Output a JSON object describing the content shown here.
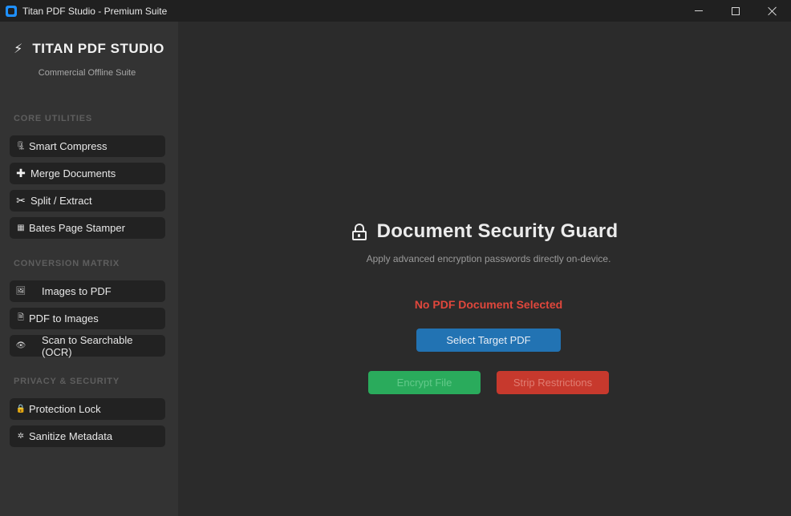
{
  "window": {
    "title": "Titan PDF Studio - Premium Suite",
    "icons": {
      "minimize": "minimize-icon",
      "maximize": "maximize-icon",
      "close": "close-icon"
    }
  },
  "sidebar": {
    "brand_icon": "⚡",
    "brand_title": "TITAN PDF STUDIO",
    "brand_subtitle": "Commercial Offline Suite",
    "sections": [
      {
        "label": "CORE UTILITIES",
        "items": [
          {
            "icon": "🗜",
            "label": "Smart Compress"
          },
          {
            "icon": "✚",
            "label": "Merge Documents"
          },
          {
            "icon": "✂",
            "label": "Split / Extract"
          },
          {
            "icon": "▦",
            "label": "Bates Page Stamper"
          }
        ]
      },
      {
        "label": "CONVERSION MATRIX",
        "items": [
          {
            "icon": "🖼",
            "label": "Images to PDF"
          },
          {
            "icon": "🗎",
            "label": "PDF to Images"
          },
          {
            "icon": "👁",
            "label": "Scan to Searchable (OCR)"
          }
        ]
      },
      {
        "label": "PRIVACY & SECURITY",
        "items": [
          {
            "icon": "🔒",
            "label": "Protection Lock"
          },
          {
            "icon": "✲",
            "label": "Sanitize Metadata"
          }
        ]
      }
    ]
  },
  "main": {
    "heading": "Document Security Guard",
    "subtitle": "Apply advanced encryption passwords directly on-device.",
    "status": "No PDF Document Selected",
    "select_button": "Select Target PDF",
    "encrypt_button": "Encrypt File",
    "strip_button": "Strip Restrictions"
  },
  "colors": {
    "status_error": "#e0473c",
    "primary_blue": "#2273b3",
    "encrypt_green": "#2aab5c",
    "strip_red": "#c7392d"
  }
}
